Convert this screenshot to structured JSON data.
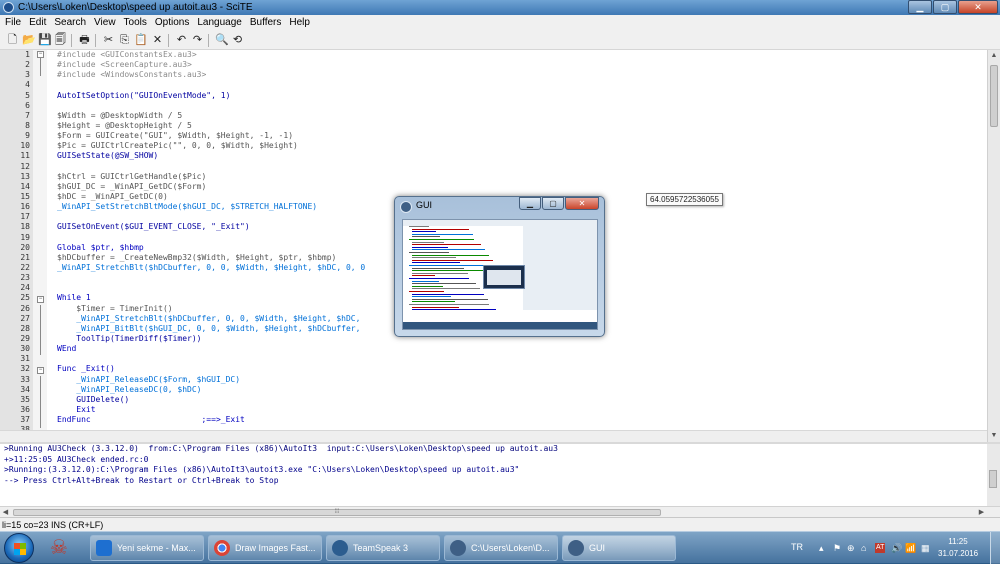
{
  "window": {
    "title": "C:\\Users\\Loken\\Desktop\\speed up autoit.au3 - SciTE",
    "minimize_glyph": "▁",
    "maximize_glyph": "▢",
    "close_glyph": "✕"
  },
  "menu": [
    "File",
    "Edit",
    "Search",
    "View",
    "Tools",
    "Options",
    "Language",
    "Buffers",
    "Help"
  ],
  "toolbar": {
    "icons": [
      "new-file-icon",
      "open-folder-icon",
      "save-icon",
      "save-as-icon",
      "print-icon",
      "cut-icon",
      "copy-icon",
      "paste-icon",
      "delete-icon",
      "undo-icon",
      "redo-icon",
      "find-icon",
      "replace-icon"
    ],
    "glyphs": [
      "🗋",
      "📂",
      "💾",
      "🗐",
      "🖶",
      "✂",
      "⎘",
      "📋",
      "✕",
      "↶",
      "↷",
      "🔍",
      "⟲"
    ]
  },
  "editor": {
    "lines": [
      {
        "n": "1",
        "text": "#include <GUIConstantsEx.au3>"
      },
      {
        "n": "2",
        "text": "#include <ScreenCapture.au3>"
      },
      {
        "n": "3",
        "text": "#include <WindowsConstants.au3>"
      },
      {
        "n": "4",
        "text": ""
      },
      {
        "n": "5",
        "text": "AutoItSetOption(\"GUIOnEventMode\", 1)"
      },
      {
        "n": "6",
        "text": ""
      },
      {
        "n": "7",
        "text": "$Width = @DesktopWidth / 5"
      },
      {
        "n": "8",
        "text": "$Height = @DesktopHeight / 5"
      },
      {
        "n": "9",
        "text": "$Form = GUICreate(\"GUI\", $Width, $Height, -1, -1)"
      },
      {
        "n": "10",
        "text": "$Pic = GUICtrlCreatePic(\"\", 0, 0, $Width, $Height)"
      },
      {
        "n": "11",
        "text": "GUISetState(@SW_SHOW)"
      },
      {
        "n": "12",
        "text": ""
      },
      {
        "n": "13",
        "text": "$hCtrl = GUICtrlGetHandle($Pic)"
      },
      {
        "n": "14",
        "text": "$hGUI_DC = _WinAPI_GetDC($Form)"
      },
      {
        "n": "15",
        "text": "$hDC = _WinAPI_GetDC(0)"
      },
      {
        "n": "16",
        "text": "_WinAPI_SetStretchBltMode($hGUI_DC, $STRETCH_HALFTONE)"
      },
      {
        "n": "17",
        "text": ""
      },
      {
        "n": "18",
        "text": "GUISetOnEvent($GUI_EVENT_CLOSE, \"_Exit\")"
      },
      {
        "n": "19",
        "text": ""
      },
      {
        "n": "20",
        "text": "Global $ptr, $hbmp"
      },
      {
        "n": "21",
        "text": "$hDCbuffer = _CreateNewBmp32($Width, $Height, $ptr, $hbmp)"
      },
      {
        "n": "22",
        "text": "_WinAPI_StretchBlt($hDCbuffer, 0, 0, $Width, $Height, $hDC, 0, 0                          Y)"
      },
      {
        "n": "23",
        "text": ""
      },
      {
        "n": "24",
        "text": ""
      },
      {
        "n": "25",
        "text": "While 1"
      },
      {
        "n": "26",
        "text": "    $Timer = TimerInit()"
      },
      {
        "n": "27",
        "text": "    _WinAPI_StretchBlt($hDCbuffer, 0, 0, $Width, $Height, $hDC,                                    PYCOPY)"
      },
      {
        "n": "28",
        "text": "    _WinAPI_BitBlt($hGUI_DC, 0, 0, $Width, $Height, $hDCbuffer,"
      },
      {
        "n": "29",
        "text": "    ToolTip(TimerDiff($Timer))"
      },
      {
        "n": "30",
        "text": "WEnd"
      },
      {
        "n": "31",
        "text": ""
      },
      {
        "n": "32",
        "text": "Func _Exit()"
      },
      {
        "n": "33",
        "text": "    _WinAPI_ReleaseDC($Form, $hGUI_DC)"
      },
      {
        "n": "34",
        "text": "    _WinAPI_ReleaseDC(0, $hDC)"
      },
      {
        "n": "35",
        "text": "    GUIDelete()"
      },
      {
        "n": "36",
        "text": "    Exit"
      },
      {
        "n": "37",
        "text": "EndFunc                       ;==>_Exit"
      },
      {
        "n": "38",
        "text": ""
      }
    ]
  },
  "output": {
    "lines": [
      ">Running AU3Check (3.3.12.0)  from:C:\\Program Files (x86)\\AutoIt3  input:C:\\Users\\Loken\\Desktop\\speed up autoit.au3",
      "+>11:25:05 AU3Check ended.rc:0",
      ">Running:(3.3.12.0):C:\\Program Files (x86)\\AutoIt3\\autoit3.exe \"C:\\Users\\Loken\\Desktop\\speed up autoit.au3\"",
      "--> Press Ctrl+Alt+Break to Restart or Ctrl+Break to Stop"
    ]
  },
  "hscroll_grip": "⁞⁞⁞",
  "statusbar": {
    "text": "li=15 co=23 INS (CR+LF)"
  },
  "gui_window": {
    "title": "GUI"
  },
  "tooltip": {
    "text": "64.0595722536055"
  },
  "taskbar": {
    "tasks": [
      {
        "label": "Yeni sekme - Max...",
        "icon_color": "#1e6fd0",
        "icon": "maxthon-icon"
      },
      {
        "label": "Draw Images Fast...",
        "icon_color": "#dd4b39",
        "icon": "chrome-icon"
      },
      {
        "label": "TeamSpeak 3",
        "icon_color": "#2c5d8f",
        "icon": "teamspeak-icon"
      },
      {
        "label": "C:\\Users\\Loken\\D...",
        "icon_color": "#3e5f85",
        "icon": "scite-icon"
      },
      {
        "label": "GUI",
        "icon_color": "#3e5f85",
        "icon": "autoit-gui-icon"
      }
    ],
    "lang": "TR",
    "tray_icons": [
      "▴",
      "⚑",
      "⊕",
      "⌂",
      "AT",
      "🔊",
      "📶",
      "▦"
    ],
    "clock_time": "11:25",
    "clock_date": "31.07.2016"
  }
}
